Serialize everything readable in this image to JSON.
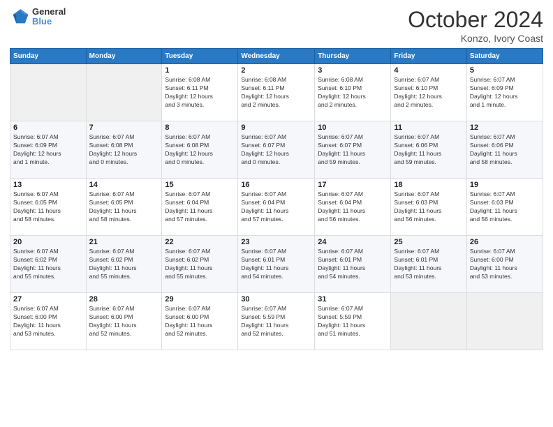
{
  "header": {
    "logo_line1": "General",
    "logo_line2": "Blue",
    "month_title": "October 2024",
    "location": "Konzo, Ivory Coast"
  },
  "days_of_week": [
    "Sunday",
    "Monday",
    "Tuesday",
    "Wednesday",
    "Thursday",
    "Friday",
    "Saturday"
  ],
  "weeks": [
    [
      {
        "day": "",
        "info": ""
      },
      {
        "day": "",
        "info": ""
      },
      {
        "day": "1",
        "info": "Sunrise: 6:08 AM\nSunset: 6:11 PM\nDaylight: 12 hours\nand 3 minutes."
      },
      {
        "day": "2",
        "info": "Sunrise: 6:08 AM\nSunset: 6:11 PM\nDaylight: 12 hours\nand 2 minutes."
      },
      {
        "day": "3",
        "info": "Sunrise: 6:08 AM\nSunset: 6:10 PM\nDaylight: 12 hours\nand 2 minutes."
      },
      {
        "day": "4",
        "info": "Sunrise: 6:07 AM\nSunset: 6:10 PM\nDaylight: 12 hours\nand 2 minutes."
      },
      {
        "day": "5",
        "info": "Sunrise: 6:07 AM\nSunset: 6:09 PM\nDaylight: 12 hours\nand 1 minute."
      }
    ],
    [
      {
        "day": "6",
        "info": "Sunrise: 6:07 AM\nSunset: 6:09 PM\nDaylight: 12 hours\nand 1 minute."
      },
      {
        "day": "7",
        "info": "Sunrise: 6:07 AM\nSunset: 6:08 PM\nDaylight: 12 hours\nand 0 minutes."
      },
      {
        "day": "8",
        "info": "Sunrise: 6:07 AM\nSunset: 6:08 PM\nDaylight: 12 hours\nand 0 minutes."
      },
      {
        "day": "9",
        "info": "Sunrise: 6:07 AM\nSunset: 6:07 PM\nDaylight: 12 hours\nand 0 minutes."
      },
      {
        "day": "10",
        "info": "Sunrise: 6:07 AM\nSunset: 6:07 PM\nDaylight: 11 hours\nand 59 minutes."
      },
      {
        "day": "11",
        "info": "Sunrise: 6:07 AM\nSunset: 6:06 PM\nDaylight: 11 hours\nand 59 minutes."
      },
      {
        "day": "12",
        "info": "Sunrise: 6:07 AM\nSunset: 6:06 PM\nDaylight: 11 hours\nand 58 minutes."
      }
    ],
    [
      {
        "day": "13",
        "info": "Sunrise: 6:07 AM\nSunset: 6:05 PM\nDaylight: 11 hours\nand 58 minutes."
      },
      {
        "day": "14",
        "info": "Sunrise: 6:07 AM\nSunset: 6:05 PM\nDaylight: 11 hours\nand 58 minutes."
      },
      {
        "day": "15",
        "info": "Sunrise: 6:07 AM\nSunset: 6:04 PM\nDaylight: 11 hours\nand 57 minutes."
      },
      {
        "day": "16",
        "info": "Sunrise: 6:07 AM\nSunset: 6:04 PM\nDaylight: 11 hours\nand 57 minutes."
      },
      {
        "day": "17",
        "info": "Sunrise: 6:07 AM\nSunset: 6:04 PM\nDaylight: 11 hours\nand 56 minutes."
      },
      {
        "day": "18",
        "info": "Sunrise: 6:07 AM\nSunset: 6:03 PM\nDaylight: 11 hours\nand 56 minutes."
      },
      {
        "day": "19",
        "info": "Sunrise: 6:07 AM\nSunset: 6:03 PM\nDaylight: 11 hours\nand 56 minutes."
      }
    ],
    [
      {
        "day": "20",
        "info": "Sunrise: 6:07 AM\nSunset: 6:02 PM\nDaylight: 11 hours\nand 55 minutes."
      },
      {
        "day": "21",
        "info": "Sunrise: 6:07 AM\nSunset: 6:02 PM\nDaylight: 11 hours\nand 55 minutes."
      },
      {
        "day": "22",
        "info": "Sunrise: 6:07 AM\nSunset: 6:02 PM\nDaylight: 11 hours\nand 55 minutes."
      },
      {
        "day": "23",
        "info": "Sunrise: 6:07 AM\nSunset: 6:01 PM\nDaylight: 11 hours\nand 54 minutes."
      },
      {
        "day": "24",
        "info": "Sunrise: 6:07 AM\nSunset: 6:01 PM\nDaylight: 11 hours\nand 54 minutes."
      },
      {
        "day": "25",
        "info": "Sunrise: 6:07 AM\nSunset: 6:01 PM\nDaylight: 11 hours\nand 53 minutes."
      },
      {
        "day": "26",
        "info": "Sunrise: 6:07 AM\nSunset: 6:00 PM\nDaylight: 11 hours\nand 53 minutes."
      }
    ],
    [
      {
        "day": "27",
        "info": "Sunrise: 6:07 AM\nSunset: 6:00 PM\nDaylight: 11 hours\nand 53 minutes."
      },
      {
        "day": "28",
        "info": "Sunrise: 6:07 AM\nSunset: 6:00 PM\nDaylight: 11 hours\nand 52 minutes."
      },
      {
        "day": "29",
        "info": "Sunrise: 6:07 AM\nSunset: 6:00 PM\nDaylight: 11 hours\nand 52 minutes."
      },
      {
        "day": "30",
        "info": "Sunrise: 6:07 AM\nSunset: 5:59 PM\nDaylight: 11 hours\nand 52 minutes."
      },
      {
        "day": "31",
        "info": "Sunrise: 6:07 AM\nSunset: 5:59 PM\nDaylight: 11 hours\nand 51 minutes."
      },
      {
        "day": "",
        "info": ""
      },
      {
        "day": "",
        "info": ""
      }
    ]
  ]
}
